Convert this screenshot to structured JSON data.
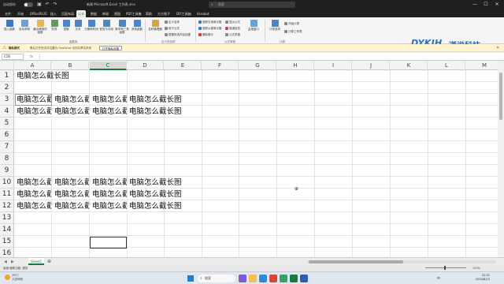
{
  "titlebar": {
    "autosave": "自动保存",
    "title": "新建 Microsoft Excel 工作表.xlsx",
    "search": "搜索",
    "close": "✕",
    "min": "—",
    "max": "☐"
  },
  "tabs": [
    "文件",
    "开始",
    "OfficePLUS",
    "插入",
    "页面布局",
    "公式",
    "数据",
    "审阅",
    "视图",
    "PDF工具集",
    "帮助",
    "方方格子",
    "DIY工具箱",
    "Acrobat"
  ],
  "active_tab": "公式",
  "ribbon": {
    "groups": [
      "函数库",
      "定义的名称",
      "公式审核",
      "计算"
    ],
    "big_buttons": [
      "插入函数",
      "自动求和",
      "最近使用的函数",
      "财务",
      "逻辑",
      "文本",
      "日期和时间",
      "查找与引用",
      "数学和三角函数",
      "其他函数",
      "名称管理器",
      "监视窗口",
      "计算选项"
    ],
    "small_buttons": [
      "定义名称",
      "用于公式",
      "根据所选内容创建",
      "追踪引用单元格",
      "追踪从属单元格",
      "删除箭头",
      "显示公式",
      "错误检查",
      "公式求值",
      "开始计算",
      "计算工作表"
    ]
  },
  "logo": {
    "mark": "DYKJH",
    "text": "道说科技社"
  },
  "infobar": {
    "label": "隐私模式",
    "message": "默认打开的文件位置为 OneDrive 中的共享文件夹",
    "button": "打开隐私设置",
    "close": "✕"
  },
  "formulabar": {
    "namebox": "C16",
    "fx": "fx"
  },
  "columns": [
    "A",
    "B",
    "C",
    "D",
    "E",
    "F",
    "G",
    "H",
    "I",
    "J",
    "K",
    "L",
    "M"
  ],
  "selected_column": "C",
  "rows": [
    "1",
    "2",
    "3",
    "4",
    "5",
    "6",
    "7",
    "8",
    "9",
    "10",
    "11",
    "12",
    "13",
    "14",
    "15",
    "16"
  ],
  "cells": {
    "r1": "电脑怎么截长图",
    "r3": [
      "电脑怎么截",
      "电脑怎么截",
      "电脑怎么截",
      "电脑怎么截长图"
    ],
    "r4": [
      "电脑怎么截",
      "电脑怎么截",
      "电脑怎么截",
      "电脑怎么截长图"
    ],
    "r10": [
      "电脑怎么截",
      "电脑怎么截",
      "电脑怎么截",
      "电脑怎么截长图"
    ],
    "r11": [
      "电脑怎么截",
      "电脑怎么截",
      "电脑怎么截",
      "电脑怎么截长图"
    ],
    "r12": [
      "电脑怎么截",
      "电脑怎么截",
      "电脑怎么截",
      "电脑怎么截长图"
    ]
  },
  "sheets": [
    "Sheet1"
  ],
  "statusbar": {
    "status": "就绪  辅助功能: 调查",
    "zoom": "100%"
  },
  "taskbar": {
    "weather_temp": "29°C",
    "weather_text": "大部晴朗",
    "search": "搜索",
    "tray": "中",
    "time": "22:31",
    "date": "2024/8/15"
  },
  "colors": {
    "accent": "#1a7a43",
    "logo": "#2a6fb8",
    "infobar": "#fff4ce"
  }
}
